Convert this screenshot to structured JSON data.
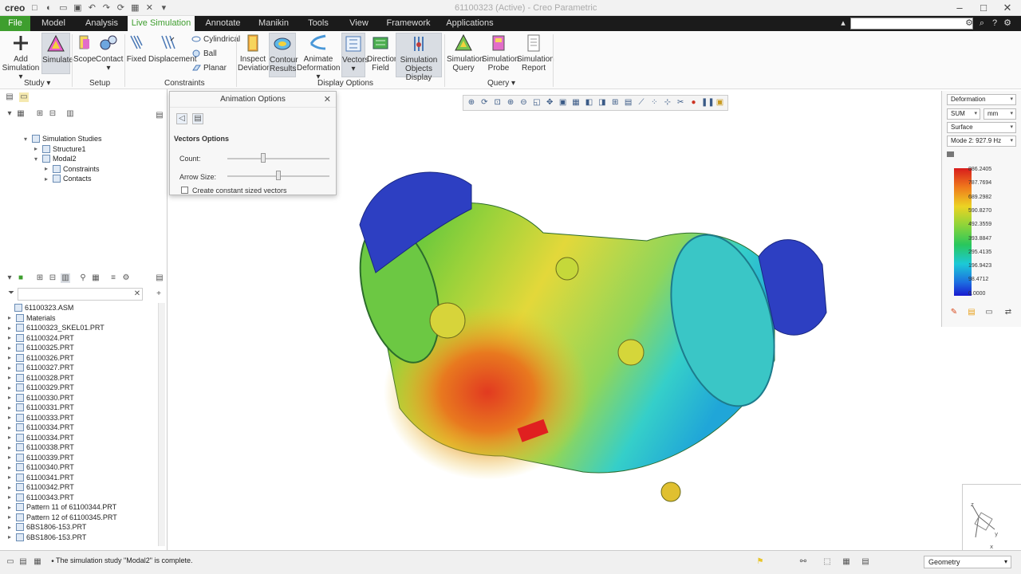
{
  "app": {
    "logo": "creo",
    "window_title": "61100323 (Active) - Creo Parametric"
  },
  "tabs": [
    "File",
    "Model",
    "Analysis",
    "Live Simulation",
    "Annotate",
    "Manikin",
    "Tools",
    "View",
    "Framework",
    "Applications"
  ],
  "ribbon": {
    "study": {
      "label": "Study",
      "add_simulation": "Add Simulation",
      "simulate": "Simulate"
    },
    "setup": {
      "label": "Setup",
      "scope": "Scope",
      "contact": "Contact"
    },
    "constraints": {
      "label": "Constraints",
      "fixed": "Fixed",
      "displacement": "Displacement",
      "cylindrical": "Cylindrical",
      "ball": "Ball",
      "planar": "Planar"
    },
    "display_options": {
      "label": "Display Options",
      "inspect_deviation": "Inspect Deviation",
      "contour_results": "Contour Results",
      "animate_deformation": "Animate Deformation",
      "vectors": "Vectors",
      "direction_field": "Direction Field",
      "simulation_objects_display": "Simulation Objects Display"
    },
    "query": {
      "label": "Query",
      "simulation_query": "Simulation Query",
      "simulation_probe": "Simulation Probe",
      "simulation_report": "Simulation Report"
    }
  },
  "sim_tree": [
    {
      "label": "Simulation Studies",
      "level": 0,
      "toggle": "▾"
    },
    {
      "label": "Structure1",
      "level": 1,
      "toggle": "▸"
    },
    {
      "label": "Modal2",
      "level": 1,
      "toggle": "▾"
    },
    {
      "label": "Constraints",
      "level": 2,
      "toggle": "▸"
    },
    {
      "label": "Contacts",
      "level": 2,
      "toggle": "▸"
    }
  ],
  "model_tree": [
    "61100323.ASM",
    "Materials",
    "61100323_SKEL01.PRT",
    "61100324.PRT",
    "61100325.PRT",
    "61100326.PRT",
    "61100327.PRT",
    "61100328.PRT",
    "61100329.PRT",
    "61100330.PRT",
    "61100331.PRT",
    "61100333.PRT",
    "61100334.PRT",
    "61100334.PRT",
    "61100338.PRT",
    "61100339.PRT",
    "61100340.PRT",
    "61100341.PRT",
    "61100342.PRT",
    "61100343.PRT",
    "Pattern 11 of 61100344.PRT",
    "Pattern 12 of 61100345.PRT",
    "6BS1806-153.PRT",
    "6BS1806-153.PRT"
  ],
  "anim_dialog": {
    "title": "Animation Options",
    "section": "Vectors Options",
    "count_label": "Count:",
    "count_level": 0.35,
    "arrow_label": "Arrow Size:",
    "arrow_level": 0.5,
    "constant_label": "Create constant sized vectors",
    "constant_checked": false
  },
  "results_panel": {
    "quantity": "Deformation",
    "component": "SUM",
    "unit": "mm",
    "display": "Surface",
    "mode": "Mode 2: 927.9 Hz",
    "legend": [
      "886.2405",
      "787.7694",
      "689.2982",
      "590.8270",
      "492.3559",
      "393.8847",
      "295.4135",
      "196.9423",
      "98.4712",
      "0.0000"
    ]
  },
  "status": {
    "message": "The simulation study \"Modal2\" is complete.",
    "selection_filter": "Geometry"
  },
  "colors": {
    "file_tab": "#3e9e2e",
    "active_tab_text": "#3e9e2e",
    "tab_bar": "#1b1b1b"
  }
}
